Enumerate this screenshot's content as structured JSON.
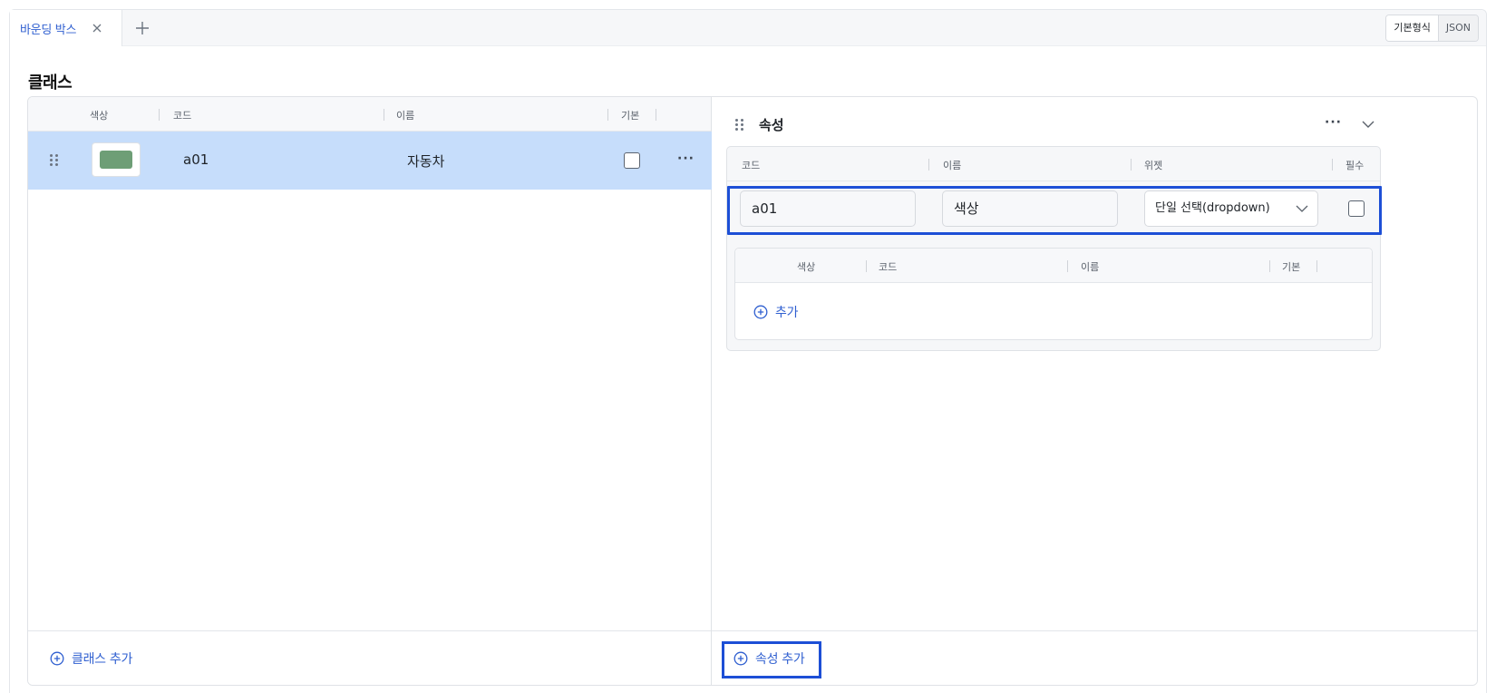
{
  "tabs": [
    {
      "label": "바운딩 박스",
      "active": true
    }
  ],
  "view_toggle": {
    "basic": "기본형식",
    "json": "JSON"
  },
  "section_title": "클래스",
  "class_table": {
    "columns": [
      "색상",
      "코드",
      "이름",
      "기본"
    ],
    "rows": [
      {
        "color": "#6e9e76",
        "code": "a01",
        "name": "자동차",
        "default": false,
        "selected": true
      }
    ]
  },
  "add_class_label": "클래스 추가",
  "property_panel": {
    "title": "속성",
    "columns": [
      "코드",
      "이름",
      "위젯",
      "필수"
    ],
    "property": {
      "code": "a01",
      "name": "색상",
      "widget": "단일 선택(dropdown)",
      "required": false
    },
    "options_table": {
      "columns": [
        "색상",
        "코드",
        "이름",
        "기본"
      ],
      "add_label": "추가"
    }
  },
  "add_property_label": "속성 추가",
  "colors": {
    "accent": "#2f5fd0",
    "highlight": "#1d4fd6",
    "selected_row": "#c6ddfb"
  }
}
